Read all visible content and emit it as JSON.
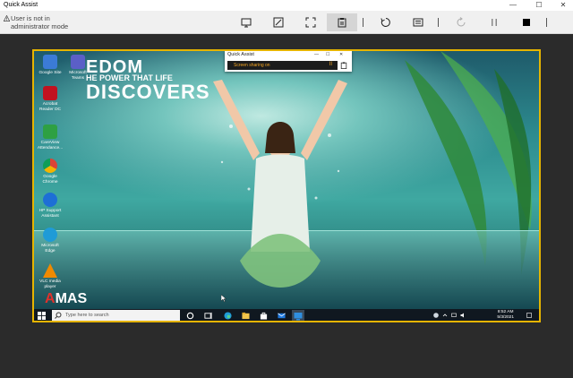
{
  "window": {
    "title": "Quick Assist",
    "controls": [
      "—",
      "☐",
      "✕"
    ]
  },
  "toolbar": {
    "warning": [
      "User is not in",
      "administrator mode"
    ],
    "tools": [
      {
        "name": "select-monitor",
        "icon": "monitor-icon"
      },
      {
        "name": "annotate",
        "icon": "pen-icon"
      },
      {
        "name": "actual-size",
        "icon": "fit-screen-icon"
      },
      {
        "name": "toggle-instruction-channel",
        "icon": "clipboard-icon"
      },
      {
        "name": "restart",
        "icon": "restart-icon"
      },
      {
        "name": "task-manager",
        "icon": "task-manager-icon"
      },
      {
        "name": "reconnect",
        "icon": "reconnect-icon"
      },
      {
        "name": "pause",
        "icon": "pause-icon"
      },
      {
        "name": "end",
        "icon": "stop-icon"
      }
    ]
  },
  "remote": {
    "wallpaper": {
      "line1": "EDOM",
      "line2": "HE POWER THAT LIFE",
      "line3": "DISCOVERS",
      "logo_a": "A",
      "logo_rest": "MAS"
    },
    "desktop_icons": [
      {
        "label": "Google Site",
        "color": "#3b7bd6"
      },
      {
        "label": "Acrobat Reader DC",
        "color": "#c1121f"
      },
      {
        "label": "CareView Attendance...",
        "color": "#2ea043"
      },
      {
        "label": "Google Chrome",
        "color": "#e9b824"
      },
      {
        "label": "HP Support Assistant",
        "color": "#1d6fd6"
      },
      {
        "label": "Microsoft Edge",
        "color": "#1f9bd7"
      },
      {
        "label": "VLC media player",
        "color": "#f08a00"
      }
    ],
    "desktop_icons_col2": [
      {
        "label": "Microsoft Teams",
        "color": "#5b5fc7"
      }
    ],
    "mini_window": {
      "title": "Quick Assist",
      "controls": [
        "—",
        "☐",
        "✕"
      ],
      "status": "Screen sharing on",
      "pause": "II"
    },
    "taskbar": {
      "search_placeholder": "Type here to search",
      "time": "8:52 AM",
      "date": "5/3/2021"
    }
  },
  "colors": {
    "accent_border": "#e6b400",
    "titlebar": "#ffffff",
    "toolbar": "#f0f0f0",
    "background": "#2b2b2b"
  }
}
